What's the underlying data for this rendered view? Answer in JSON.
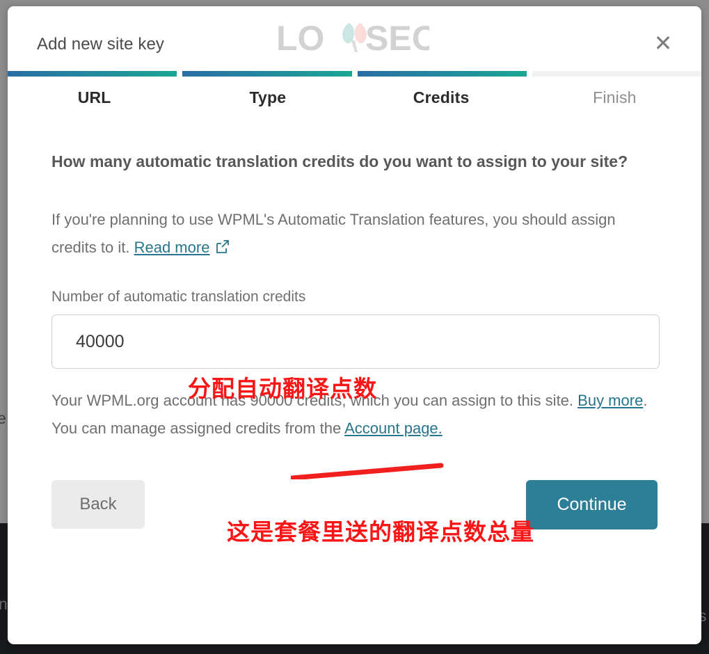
{
  "window": {
    "title": "Add new site key",
    "close_icon": "close-icon",
    "logo_text_left": "LO",
    "logo_text_right": "SEO",
    "logo_name": "loyseo-logo"
  },
  "stepper": {
    "steps": [
      {
        "label": "URL",
        "state": "done"
      },
      {
        "label": "Type",
        "state": "done"
      },
      {
        "label": "Credits",
        "state": "done"
      },
      {
        "label": "Finish",
        "state": "todo"
      }
    ],
    "active_gradient_start": "#2a6ea4",
    "active_gradient_end": "#1ba693",
    "inactive_color": "#f1f1f1"
  },
  "content": {
    "question": "How many automatic translation credits do you want to assign to your site?",
    "intro_before_link": "If you're planning to use WPML's Automatic Translation features, you should assign credits to it. ",
    "intro_link": "Read more",
    "external_link_icon": "external-link-icon",
    "field_label": "Number of automatic translation credits",
    "credits_value": "40000",
    "credits_placeholder": "0",
    "note_part1": "Your WPML.org account has 90000 credits, which you can assign to this site. ",
    "note_link_buy": "Buy more",
    "note_part2": ". You can manage assigned credits from the ",
    "note_link_account": "Account page.",
    "link_color": "#27758c"
  },
  "footer": {
    "back_label": "Back",
    "continue_label": "Continue",
    "continue_color": "#2c7f96",
    "back_color": "#ebebeb"
  },
  "annotations": {
    "color": "#fa1616",
    "credits_input_note": "分配自动翻译点数",
    "account_credits_note": "这是套餐里送的翻译点数总量",
    "underline_name": "red-underline-stroke"
  },
  "background": {
    "ghost_text_left_upper": "e",
    "ghost_text_left_lower": "n",
    "ghost_text_right": "s",
    "top_color": "#8c8c8c",
    "bottom_color": "#18191c"
  }
}
